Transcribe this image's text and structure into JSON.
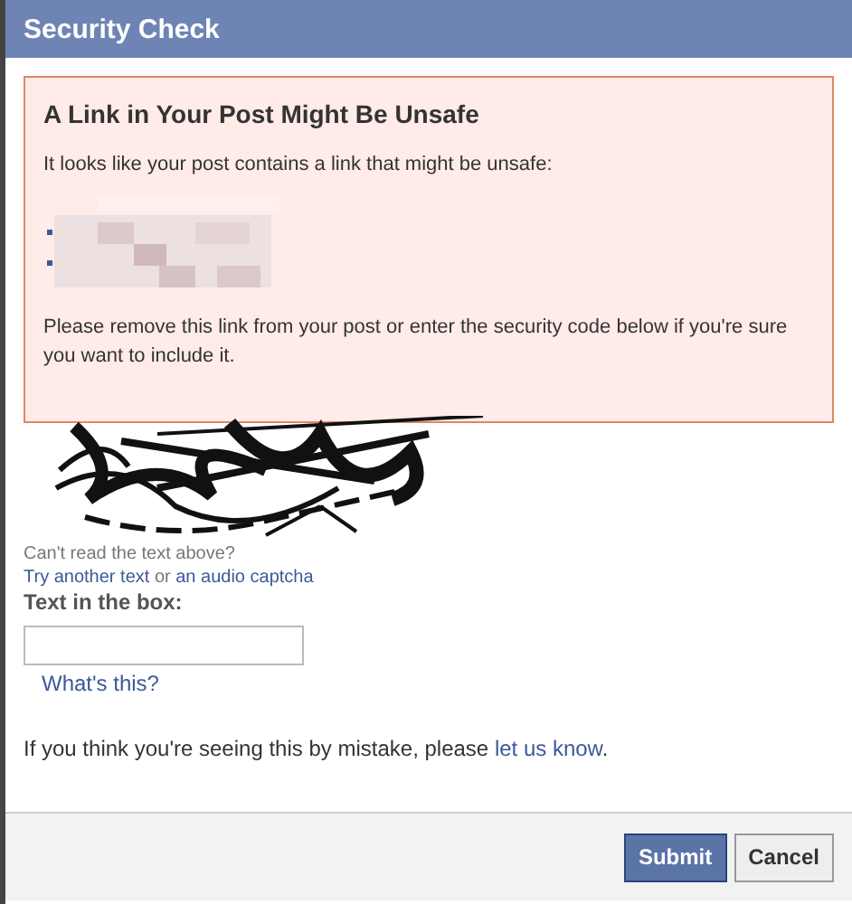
{
  "window": {
    "title": "Security Check"
  },
  "warning": {
    "heading": "A Link in Your Post Might Be Unsafe",
    "intro": "It looks like your post contains a link that might be unsafe:",
    "instruction": "Please remove this link from your post or enter the security code below if you're sure you want to include it."
  },
  "captcha": {
    "cant_read": "Can't read the text above?",
    "alternatives": [
      {
        "kind": "link",
        "text": "Try another text"
      },
      {
        "kind": "text",
        "text": " or "
      },
      {
        "kind": "link",
        "text": "an audio captcha"
      }
    ],
    "field_label": "Text in the box:",
    "help_link": "What's this?"
  },
  "mistake_note": [
    {
      "kind": "text",
      "text": "If you think you're seeing this by mistake, please "
    },
    {
      "kind": "link",
      "text": "let us know"
    },
    {
      "kind": "text",
      "text": "."
    }
  ],
  "buttons": [
    {
      "label": "Submit",
      "kind": "primary"
    },
    {
      "label": "Cancel",
      "kind": "secondary"
    }
  ]
}
